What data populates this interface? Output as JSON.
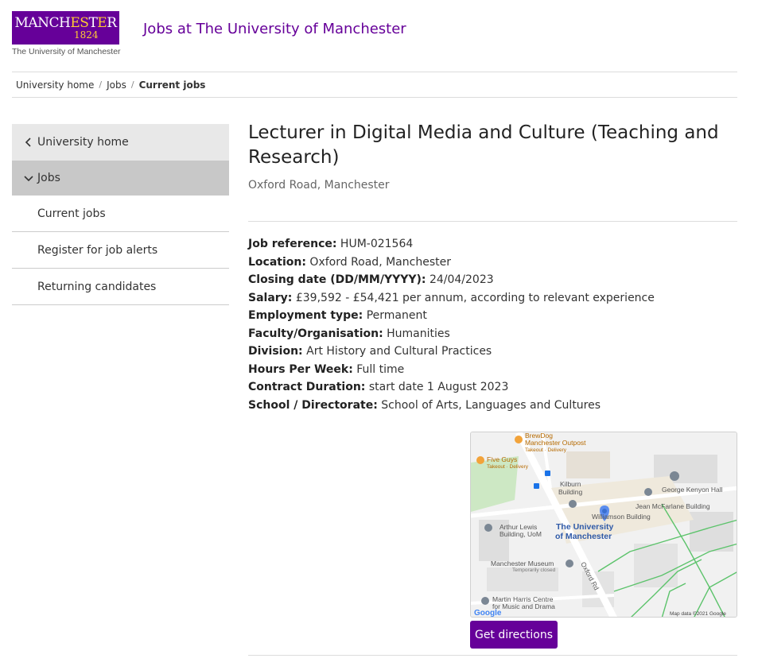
{
  "header": {
    "logo_word_left": "MANCH",
    "logo_word_gold": "ES",
    "logo_word_mid": "T",
    "logo_word_gold2": "E",
    "logo_word_right": "R",
    "logo_year": "1824",
    "logo_sub": "The University of Manchester",
    "site_title": "Jobs at The University of Manchester"
  },
  "breadcrumb": {
    "items": [
      "University home",
      "Jobs",
      "Current jobs"
    ],
    "separator": "/"
  },
  "sidebar": {
    "top_item": "University home",
    "open_item": "Jobs",
    "sub_items": [
      "Current jobs",
      "Register for job alerts",
      "Returning candidates"
    ]
  },
  "job": {
    "title": "Lecturer in Digital Media and Culture (Teaching and Research)",
    "location": "Oxford Road, Manchester",
    "details": [
      {
        "label": "Job reference:",
        "value": "HUM-021564"
      },
      {
        "label": "Location:",
        "value": "Oxford Road, Manchester"
      },
      {
        "label": "Closing date (DD/MM/YYYY):",
        "value": "24/04/2023"
      },
      {
        "label": "Salary:",
        "value": "£39,592 - £54,421 per annum, according to relevant experience"
      },
      {
        "label": "Employment type:",
        "value": "Permanent"
      },
      {
        "label": "Faculty/Organisation:",
        "value": "Humanities"
      },
      {
        "label": "Division:",
        "value": "Art History and Cultural Practices"
      },
      {
        "label": "Hours Per Week:",
        "value": "Full time"
      },
      {
        "label": "Contract Duration:",
        "value": "start date 1 August 2023"
      },
      {
        "label": "School / Directorate:",
        "value": "School of Arts, Languages and Cultures"
      }
    ]
  },
  "map": {
    "labels": {
      "brewdog": "BrewDog",
      "brewdog2": "Manchester Outpost",
      "brewdog_sub": "Takeout · Delivery",
      "fiveguys": "Five Guys",
      "fiveguys_sub": "Takeout · Delivery",
      "kilburn1": "Kilburn",
      "kilburn2": "Building",
      "kenyon": "George Kenyon Hall",
      "mcfarlane": "Jean McFarlane Building",
      "williamson": "Williamson Building",
      "arthur1": "Arthur Lewis",
      "arthur2": "Building, UoM",
      "uni1": "The University",
      "uni2": "of Manchester",
      "museum": "Manchester Museum",
      "museum_sub": "Temporarily closed",
      "oxford": "Oxford Rd",
      "martin1": "Martin Harris Centre",
      "martin2": "for Music and Drama",
      "google": "Google",
      "mapdata": "Map data ©2021 Google"
    }
  },
  "actions": {
    "directions": "Get directions"
  },
  "colors": {
    "brand_purple": "#660099",
    "brand_gold": "#ffcc33"
  }
}
